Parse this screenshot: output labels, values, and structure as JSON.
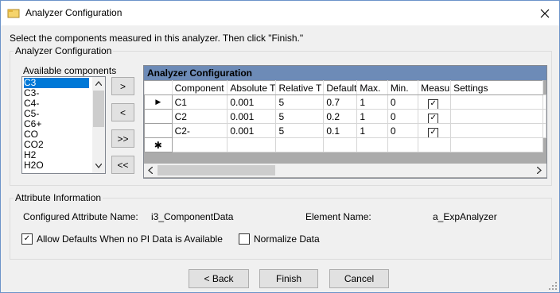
{
  "window": {
    "title": "Analyzer Configuration",
    "instructions": "Select the components measured in this analyzer. Then click \"Finish.\""
  },
  "config_group": {
    "label": "Analyzer Configuration",
    "available_label": "Available components",
    "available": [
      "C3",
      "C3-",
      "C4-",
      "C5-",
      "C6+",
      "CO",
      "CO2",
      "H2",
      "H2O"
    ],
    "selected_index": 0
  },
  "move_buttons": {
    "add": ">",
    "remove": "<",
    "add_all": ">>",
    "remove_all": "<<"
  },
  "grid": {
    "caption": "Analyzer Configuration",
    "columns": [
      "Component",
      "Absolute T",
      "Relative T",
      "Default",
      "Max.",
      "Min.",
      "Measu",
      "Settings"
    ],
    "rows": [
      {
        "component": "C1",
        "absolute": "0.001",
        "relative": "5",
        "default": "0.7",
        "max": "1",
        "min": "0",
        "measured": true,
        "settings": ""
      },
      {
        "component": "C2",
        "absolute": "0.001",
        "relative": "5",
        "default": "0.2",
        "max": "1",
        "min": "0",
        "measured": true,
        "settings": ""
      },
      {
        "component": "C2-",
        "absolute": "0.001",
        "relative": "5",
        "default": "0.1",
        "max": "1",
        "min": "0",
        "measured": true,
        "settings": ""
      }
    ],
    "current_row_glyph": "▶",
    "new_row_glyph": "✱"
  },
  "attribute_group": {
    "label": "Attribute Information",
    "configured_label": "Configured Attribute Name:",
    "configured_value": "i3_ComponentData",
    "element_label": "Element Name:",
    "element_value": "a_ExpAnalyzer",
    "allow_defaults_label": "Allow Defaults When no PI Data is Available",
    "allow_defaults_checked": true,
    "normalize_label": "Normalize Data",
    "normalize_checked": false
  },
  "footer": {
    "back": "< Back",
    "finish": "Finish",
    "cancel": "Cancel"
  },
  "icons": {
    "close": "close-icon",
    "app": "app-icon",
    "check": "✓"
  }
}
